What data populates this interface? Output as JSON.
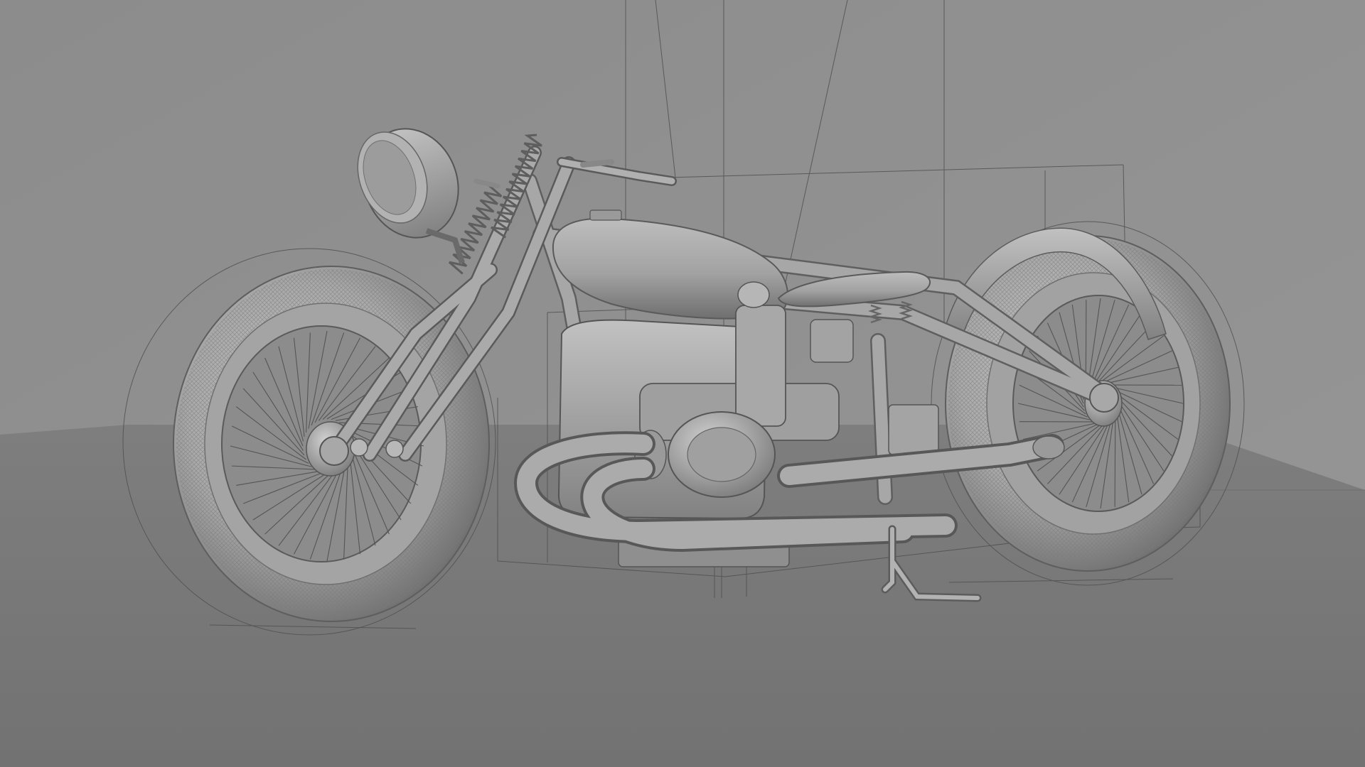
{
  "viewport": {
    "background_wall": "#8e8e8e",
    "background_floor": "#777777",
    "guide_line_color": "#4a4a4a",
    "model_base_color": "#a6a6a6",
    "model_shadow_color": "#6e6e6e",
    "model_highlight_color": "#c4c4c4"
  },
  "model": {
    "subject": "motorcycle",
    "front_wheel_spokes": 36,
    "rear_wheel_spokes": 36
  }
}
